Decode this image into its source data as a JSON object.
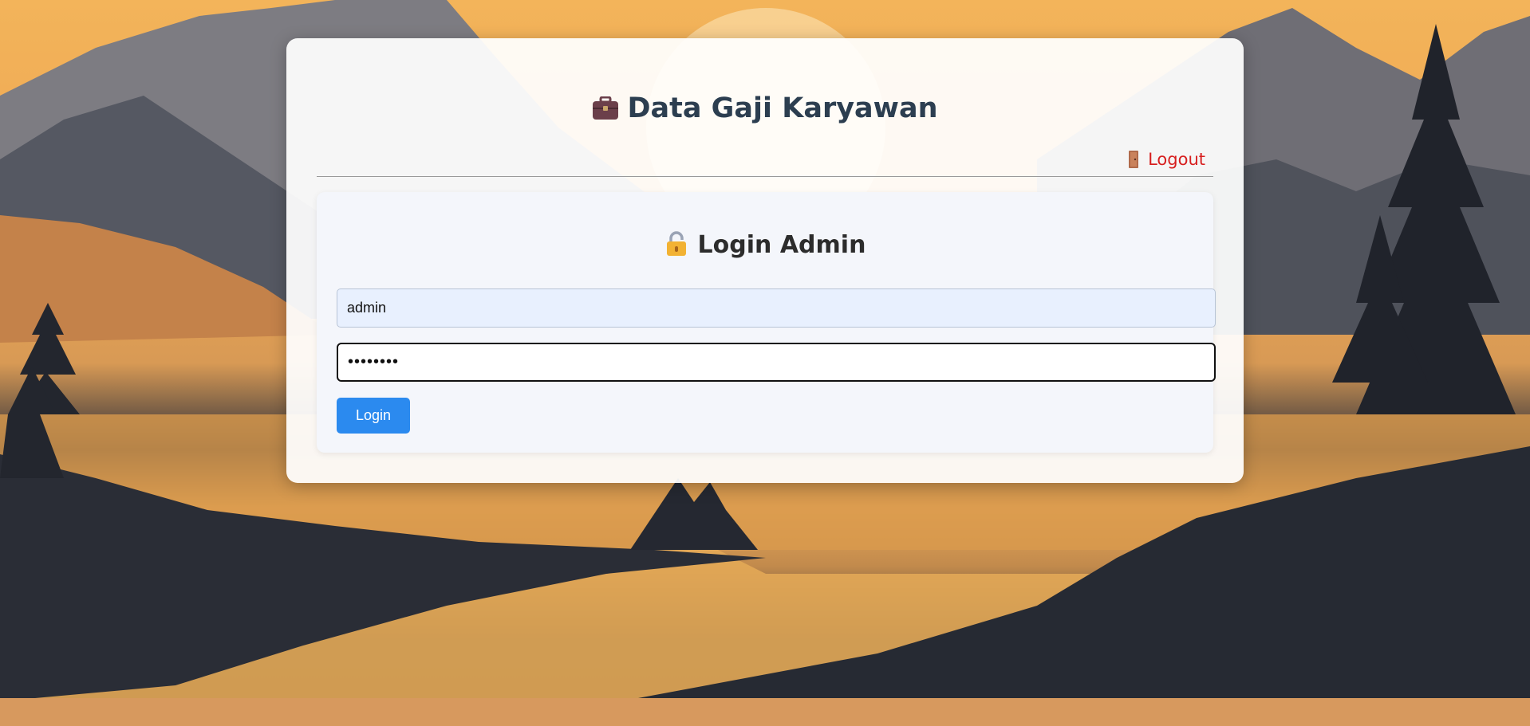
{
  "header": {
    "title": "Data Gaji Karyawan",
    "icon": "briefcase-icon",
    "icon_color": "#6b3f4a"
  },
  "nav": {
    "logout_label": "Logout",
    "logout_icon": "door-icon",
    "logout_color": "#d71e1e"
  },
  "login": {
    "title": "Login Admin",
    "icon": "lock-icon",
    "username_value": "admin",
    "password_value": "••••••••",
    "submit_label": "Login",
    "button_color": "#2b8aef"
  }
}
